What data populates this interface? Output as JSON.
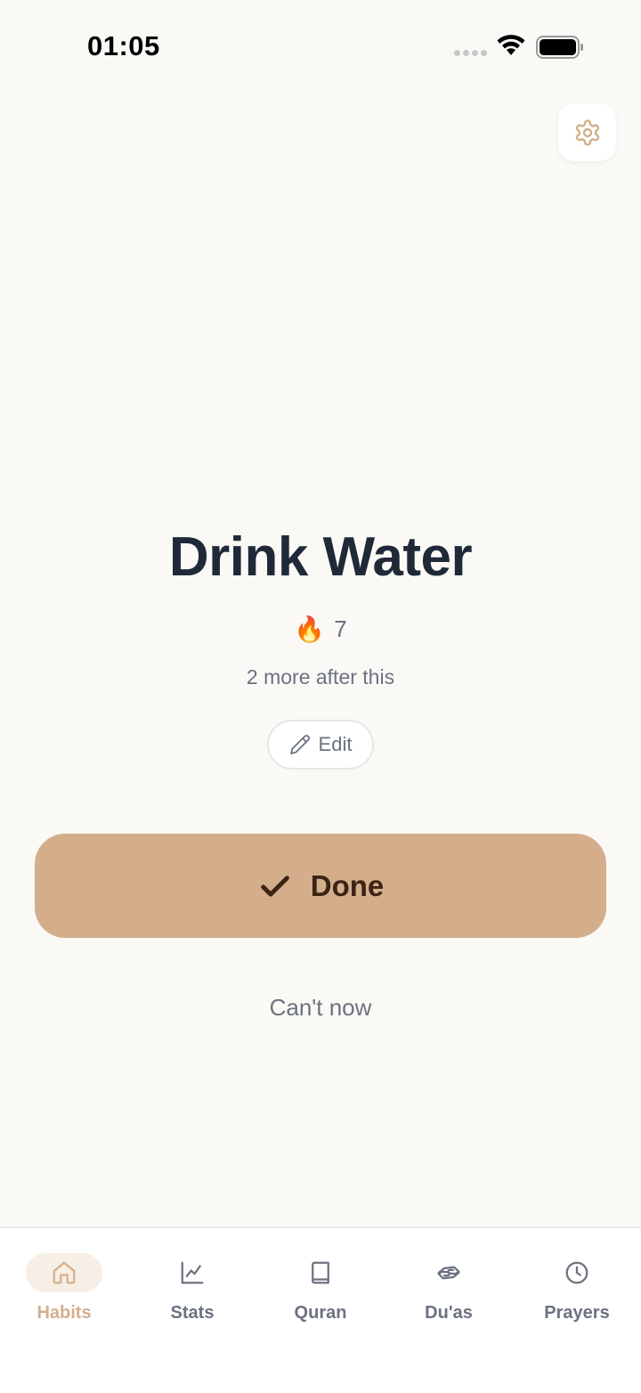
{
  "status_bar": {
    "time": "01:05"
  },
  "colors": {
    "accent": "#D4AE8B",
    "background": "#FBF9F6",
    "text_dark": "#1F2937",
    "text_muted": "#6B7280"
  },
  "habit": {
    "title": "Drink Water",
    "streak_icon": "fire-emoji",
    "streak_emoji": "🔥",
    "streak_count": "7",
    "remaining_text": "2 more after this",
    "edit_label": "Edit"
  },
  "actions": {
    "done_label": "Done",
    "cant_now_label": "Can't now"
  },
  "nav": {
    "items": [
      {
        "label": "Habits",
        "icon": "home-icon",
        "active": true
      },
      {
        "label": "Stats",
        "icon": "chart-icon",
        "active": false
      },
      {
        "label": "Quran",
        "icon": "book-icon",
        "active": false
      },
      {
        "label": "Du'as",
        "icon": "hands-icon",
        "active": false
      },
      {
        "label": "Prayers",
        "icon": "clock-icon",
        "active": false
      }
    ]
  }
}
